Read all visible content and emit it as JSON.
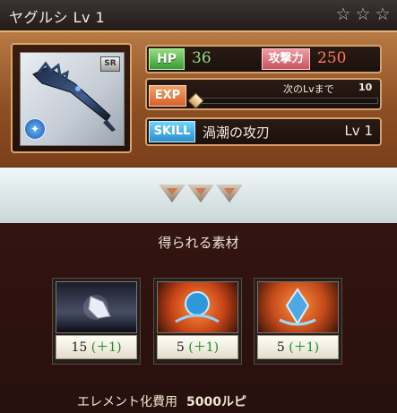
{
  "header": {
    "title": "ヤグルシ Lv 1",
    "stars": [
      "☆",
      "☆",
      "☆"
    ]
  },
  "weapon": {
    "rarity": "SR",
    "element_icon": "wind-element-icon",
    "stats": {
      "hp_label": "HP",
      "hp_value": "36",
      "atk_label": "攻撃力",
      "atk_value": "250"
    },
    "exp": {
      "label": "EXP",
      "next_label": "次のLvまで",
      "next_value": "10",
      "progress": 0.0
    },
    "skill": {
      "label": "SKILL",
      "name": "渦潮の攻刃",
      "level": "Lv 1"
    }
  },
  "upgrade_icons": [
    "upgrade-triangle-icon",
    "upgrade-triangle-icon",
    "upgrade-triangle-icon"
  ],
  "materials": {
    "title": "得られる素材",
    "items": [
      {
        "icon": "silver-shard-icon",
        "count": "15",
        "bonus": "(＋1)",
        "color": "#6b7e99"
      },
      {
        "icon": "water-orb-icon",
        "count": "5",
        "bonus": "(＋1)",
        "color": "#2e98dd"
      },
      {
        "icon": "water-crystal-icon",
        "count": "5",
        "bonus": "(＋1)",
        "color": "#4da8e6"
      }
    ]
  },
  "cost": {
    "label": "エレメント化費用",
    "value": "5000ルピ"
  },
  "colors": {
    "accent_orange": "#d6622c",
    "hp_green": "#8ee27c",
    "atk_red": "#ff7b59",
    "skill_blue": "#2b8ecc"
  }
}
